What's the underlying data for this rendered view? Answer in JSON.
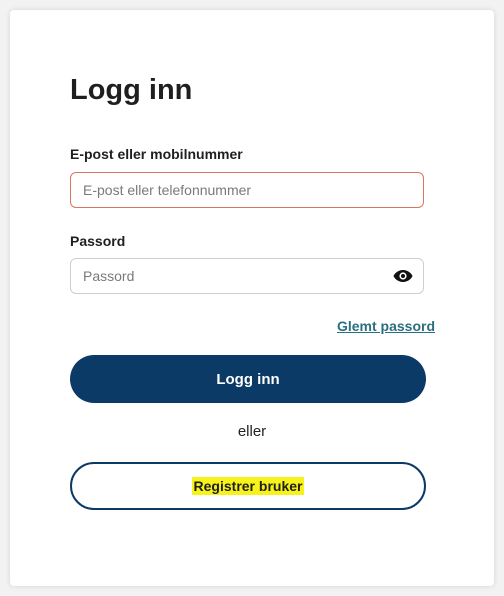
{
  "login_form": {
    "title": "Logg inn",
    "email_label": "E-post eller mobilnummer",
    "email_placeholder": "E-post eller telefonnummer",
    "email_value": "",
    "password_label": "Passord",
    "password_placeholder": "Passord",
    "password_value": "",
    "password_toggle_icon": "eye-icon",
    "forgot_password_link": "Glemt passord",
    "login_button_label": "Logg inn",
    "or_text": "eller",
    "register_button_label": "Registrer bruker"
  },
  "colors": {
    "primary": "#0b3a66",
    "email_border_error": "#d9765f",
    "link": "#2a6f7f",
    "register_highlight": "#f7f21a"
  }
}
